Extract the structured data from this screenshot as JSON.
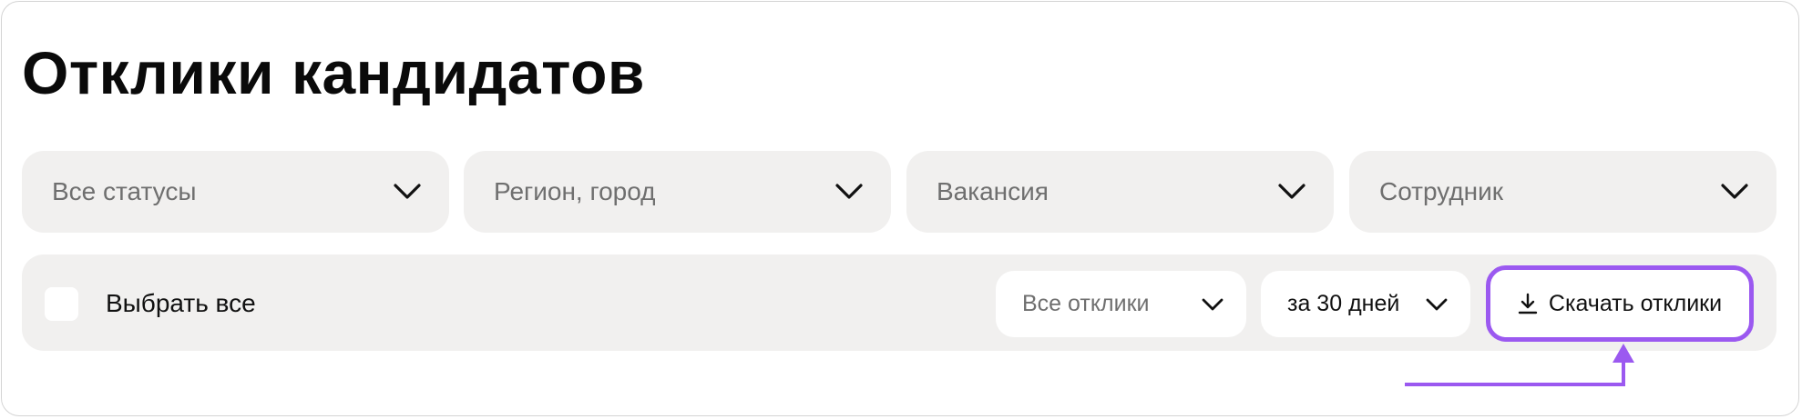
{
  "header": {
    "title": "Отклики кандидатов"
  },
  "filters": [
    {
      "placeholder": "Все статусы",
      "icon": "chevron-down-icon"
    },
    {
      "placeholder": "Регион, город",
      "icon": "chevron-down-icon"
    },
    {
      "placeholder": "Вакансия",
      "icon": "chevron-down-icon"
    },
    {
      "placeholder": "Сотрудник",
      "icon": "chevron-down-icon"
    }
  ],
  "toolbar": {
    "select_all_label": "Выбрать все",
    "select_all_checked": false,
    "responses_filter": {
      "value": "Все отклики",
      "icon": "chevron-down-icon"
    },
    "period_filter": {
      "value": "за 30 дней",
      "icon": "chevron-down-icon"
    },
    "download_button": {
      "label": "Скачать отклики",
      "icon": "download-icon"
    }
  },
  "annotation": {
    "type": "highlight-arrow",
    "target": "download_button"
  },
  "colors": {
    "accent": "#9b59f0",
    "control_background": "#f1f0ef",
    "placeholder_text": "#6f6f6f",
    "text": "#111111"
  }
}
